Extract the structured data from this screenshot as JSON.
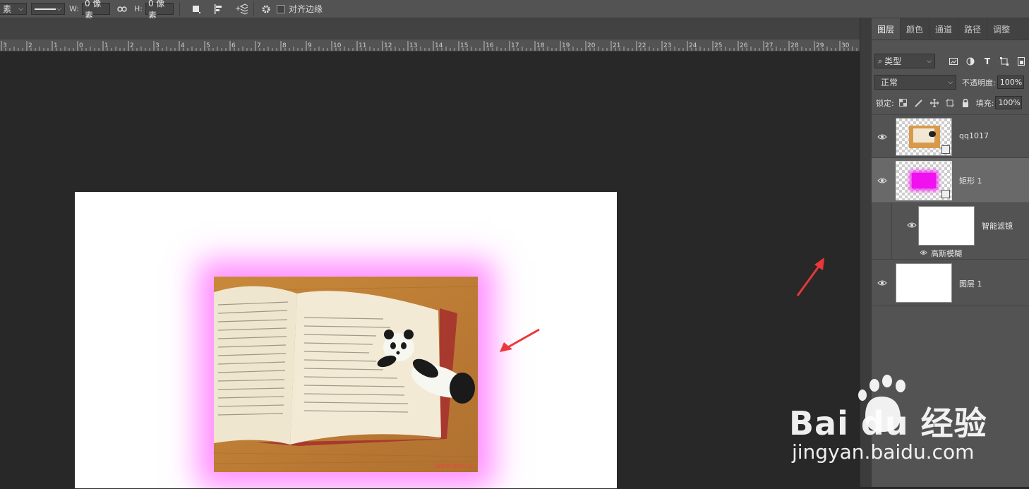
{
  "options_bar": {
    "unit_partial": "素",
    "width_label": "W:",
    "width_value": "0 像素",
    "height_label": "H:",
    "height_value": "0 像素",
    "align_edges_label": "对齐边缘",
    "align_edges_checked": false
  },
  "ruler": {
    "ticks": [
      "3",
      "2",
      "1",
      "0",
      "1",
      "2",
      "3",
      "4",
      "5",
      "6",
      "7",
      "8",
      "9",
      "10",
      "11",
      "12",
      "13",
      "14",
      "15",
      "16",
      "17",
      "18",
      "19",
      "20",
      "21",
      "22",
      "23",
      "24",
      "25",
      "26",
      "27",
      "28",
      "29",
      "30"
    ]
  },
  "layers_panel": {
    "tabs": [
      "图层",
      "颜色",
      "通道",
      "路径",
      "调整"
    ],
    "active_tab": "图层",
    "filter_label": "类型",
    "blend_mode": "正常",
    "opacity_label": "不透明度:",
    "opacity_value": "100%",
    "lock_label": "锁定:",
    "fill_label": "填充:",
    "fill_value": "100%",
    "layers": [
      {
        "name": "qq1017",
        "visible": true
      },
      {
        "name": "矩形 1",
        "visible": true,
        "selected": true
      },
      {
        "name": "智能滤镜",
        "visible": true
      },
      {
        "name": "高斯模糊",
        "visible": true
      },
      {
        "name": "图层 1",
        "visible": true
      }
    ]
  },
  "canvas": {
    "photo_url_text": "www.hnh.cc",
    "glow_color": "#ff66ff",
    "annotation_color": "#e8383a"
  },
  "watermark": {
    "brand": "Bai du 经验",
    "url": "jingyan.baidu.com"
  }
}
